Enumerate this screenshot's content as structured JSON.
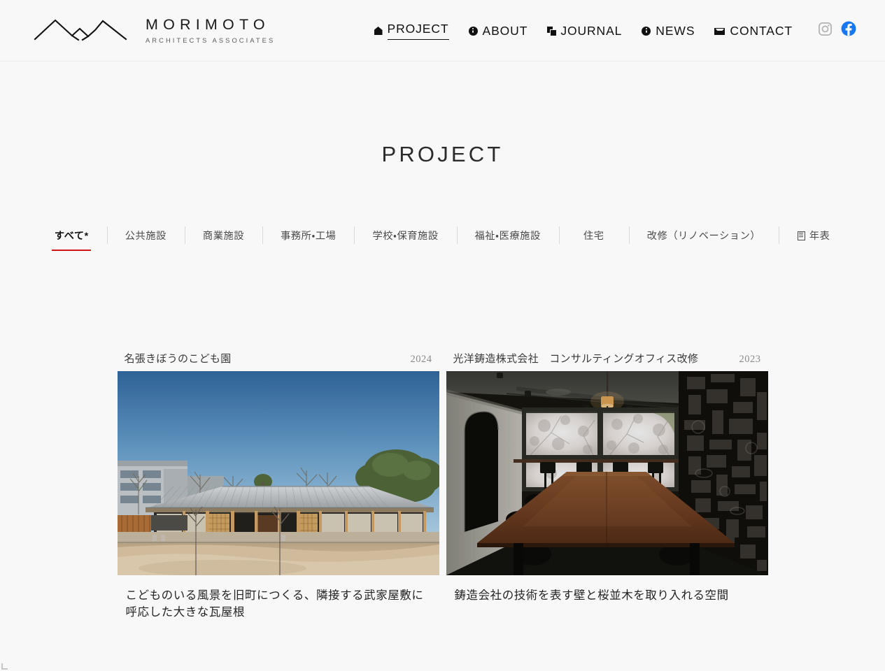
{
  "site": {
    "background_color": "#f8f8f8",
    "brand": {
      "name": "MORIMOTO",
      "subtitle": "ARCHITECTS  ASSOCIATES",
      "logo_icon": "mountain-range-logo"
    }
  },
  "header": {
    "nav": [
      {
        "label": "PROJECT",
        "icon": "pentagon-icon",
        "active": true
      },
      {
        "label": "ABOUT",
        "icon": "info-circle-icon",
        "active": false
      },
      {
        "label": "JOURNAL",
        "icon": "stacked-pages-icon",
        "active": false
      },
      {
        "label": "NEWS",
        "icon": "info-circle-icon",
        "active": false
      },
      {
        "label": "CONTACT",
        "icon": "envelope-icon",
        "active": false
      }
    ],
    "social": [
      {
        "name": "instagram",
        "icon": "instagram-icon",
        "color": "#b0b0b0"
      },
      {
        "name": "facebook",
        "icon": "facebook-icon",
        "color": "#1877f2"
      }
    ]
  },
  "main": {
    "page_title": "PROJECT",
    "active_accent_color": "#d11414",
    "filters": [
      {
        "label": "すべて*",
        "active": true,
        "icon": null
      },
      {
        "label": "公共施設",
        "active": false,
        "icon": null
      },
      {
        "label": "商業施設",
        "active": false,
        "icon": null
      },
      {
        "label": "事務所・工場",
        "active": false,
        "icon": null
      },
      {
        "label": "学校・保育施設",
        "active": false,
        "icon": null
      },
      {
        "label": "福祉・医療施設",
        "active": false,
        "icon": null
      },
      {
        "label": "住宅",
        "active": false,
        "icon": null
      },
      {
        "label": "改修（リノベーション）",
        "active": false,
        "icon": null
      },
      {
        "label": "年表",
        "active": false,
        "icon": "document-list-icon"
      }
    ],
    "projects": [
      {
        "title": "名張きぼうのこども園",
        "year": "2024",
        "caption": "こどものいる風景を旧町につくる、隣接する武家屋敷に呼応した大きな瓦屋根",
        "image_alt": "kindergarten-exterior-tiled-roof"
      },
      {
        "title": "光洋鋳造株式会社　コンサルティングオフィス改修",
        "year": "2023",
        "caption": "鋳造会社の技術を表す壁と桜並木を取り入れる空間",
        "image_alt": "dark-meeting-room-cherry-blossom-window"
      }
    ]
  }
}
